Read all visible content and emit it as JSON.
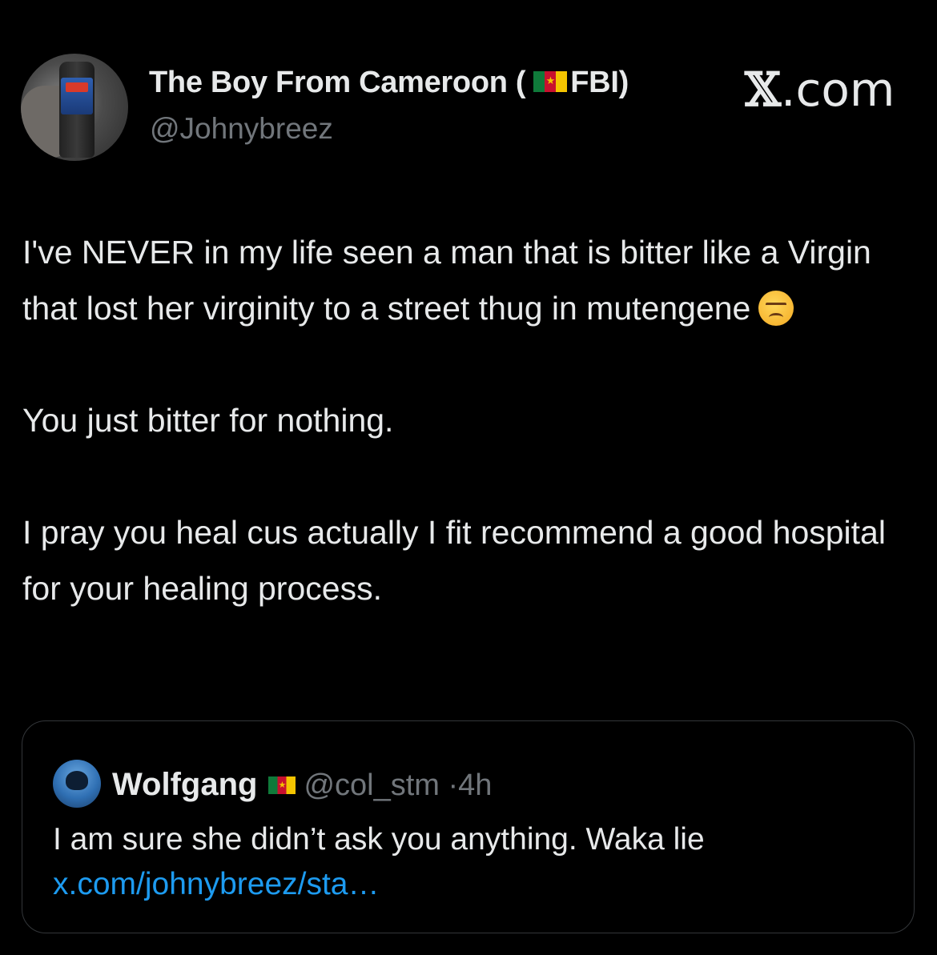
{
  "author": {
    "display_name": "The Boy From Cameroon (",
    "display_name_suffix": "FBI)",
    "handle": "@Johnybreez",
    "flag": "cameroon-flag"
  },
  "brand": {
    "x_symbol": "𝕏",
    "suffix": ".com"
  },
  "tweet": {
    "paragraph_1": "I've NEVER in my life seen a man that is bitter like a Virgin that lost her virginity to a street thug in mutengene",
    "emoji": "unamused-face-emoji",
    "paragraph_2": "You just bitter for nothing.",
    "paragraph_3": "I pray you heal cus actually I fit recommend a good hospital for your healing process."
  },
  "quoted": {
    "name": "Wolfgang",
    "handle": "@col_stm",
    "separator": "·",
    "time": "4h",
    "text": "I am sure she didn’t ask you anything. Waka lie",
    "link": "x.com/johnybreez/sta…"
  },
  "colors": {
    "background": "#000000",
    "primary_text": "#e7e9ea",
    "secondary_text": "#71767b",
    "link": "#1d9bf0",
    "border": "#333639"
  }
}
